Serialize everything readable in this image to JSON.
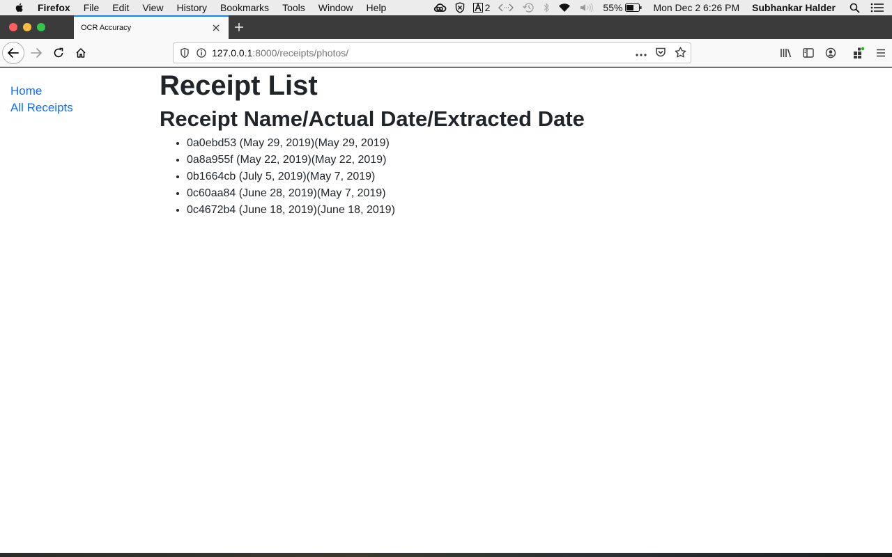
{
  "menubar": {
    "app_name": "Firefox",
    "items": [
      "File",
      "Edit",
      "View",
      "History",
      "Bookmarks",
      "Tools",
      "Window",
      "Help"
    ],
    "status": {
      "adobe_count": "2",
      "battery": "55%",
      "datetime": "Mon Dec 2  6:26 PM",
      "user": "Subhankar Halder"
    }
  },
  "browser": {
    "tab_title": "OCR Accuracy",
    "url_host": "127.0.0.1",
    "url_rest": ":8000/receipts/photos/"
  },
  "sidebar": {
    "links": [
      "Home",
      "All Receipts"
    ]
  },
  "page": {
    "title": "Receipt List",
    "subtitle": "Receipt Name/Actual Date/Extracted Date",
    "receipts": [
      "0a0ebd53 (May 29, 2019)(May 29, 2019)",
      "0a8a955f (May 22, 2019)(May 22, 2019)",
      "0b1664cb (July 5, 2019)(May 7, 2019)",
      "0c60aa84 (June 28, 2019)(May 7, 2019)",
      "0c4672b4 (June 18, 2019)(June 18, 2019)"
    ]
  },
  "colors": {
    "link": "#0d6efd",
    "tab_accent": "#0a84ff",
    "text": "#212529"
  },
  "icons": [
    "apple-icon",
    "creative-cloud-icon",
    "shield-x-icon",
    "adobe-icon",
    "code-icon",
    "time-machine-icon",
    "bluetooth-icon",
    "wifi-icon",
    "volume-icon",
    "battery-icon",
    "spotlight-icon",
    "notification-center-icon",
    "back-icon",
    "forward-icon",
    "reload-icon",
    "home-icon",
    "tracking-protection-icon",
    "site-info-icon",
    "page-actions-icon",
    "pocket-icon",
    "bookmark-star-icon",
    "library-icon",
    "sidebar-icon",
    "account-icon",
    "extensions-icon",
    "hamburger-menu-icon"
  ]
}
